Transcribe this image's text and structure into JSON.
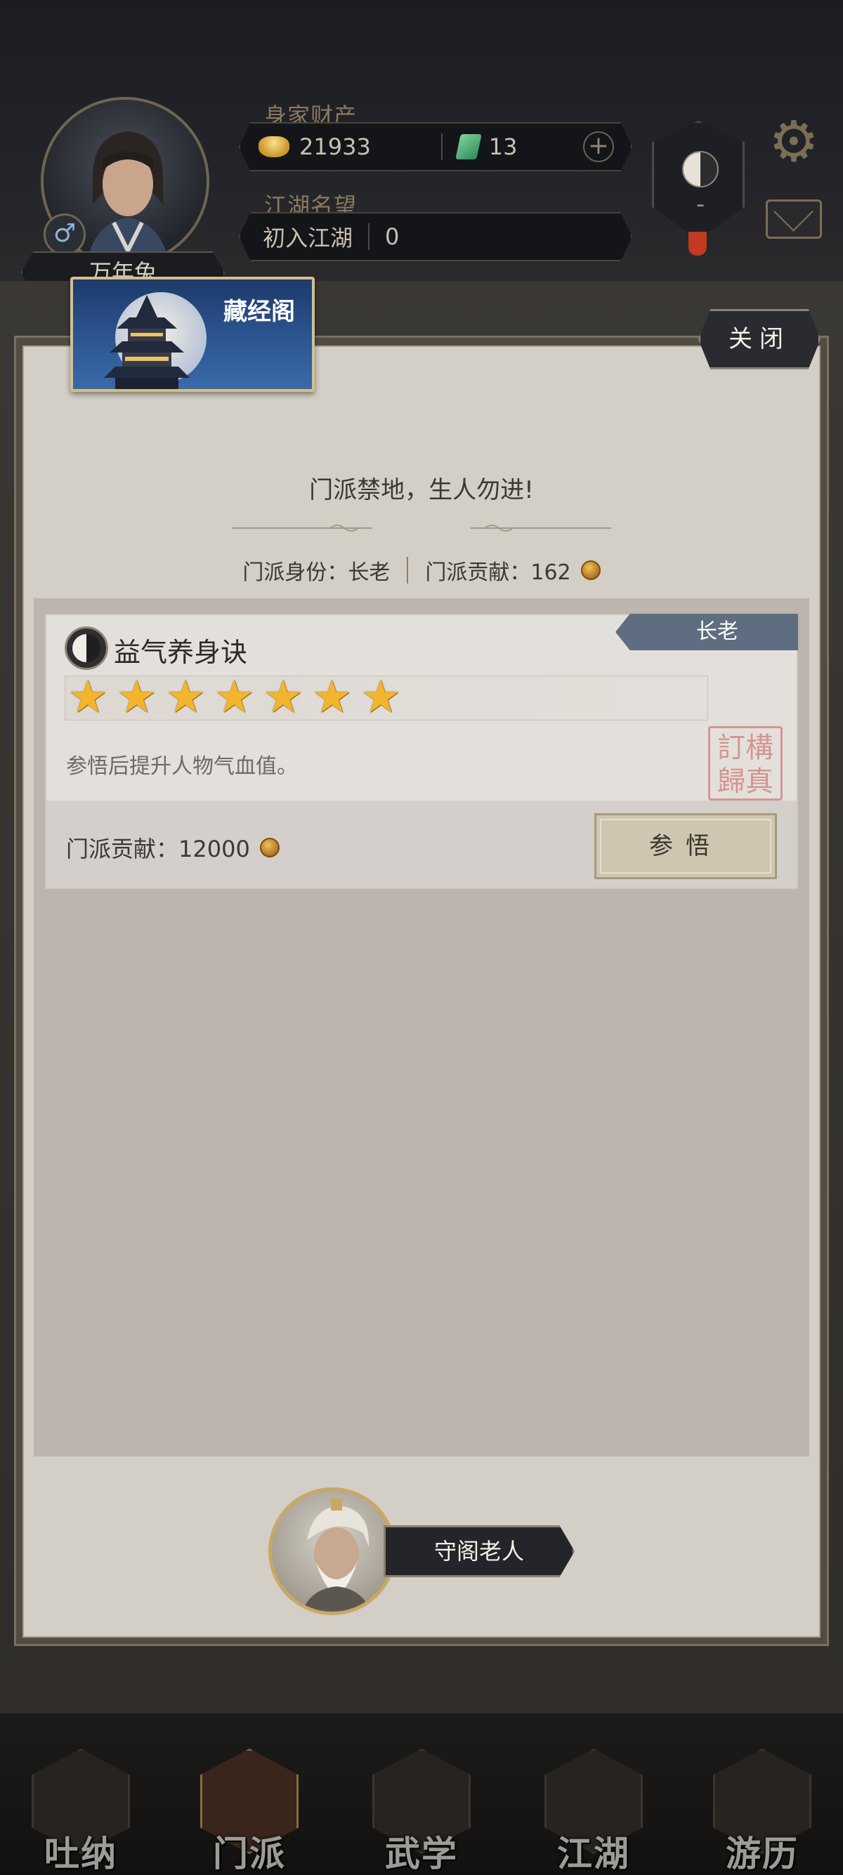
{
  "header": {
    "player_name": "万年兔",
    "gender_symbol": "♂",
    "wealth_label": "身家财产",
    "gold_amount": "21933",
    "jade_amount": "13",
    "reputation_label": "江湖名望",
    "reputation_title": "初入江湖",
    "reputation_value": "0",
    "emblem_dash": "-",
    "add_symbol": "+",
    "gear_symbol": "⚙"
  },
  "modal": {
    "title": "藏经阁",
    "close_label": "关闭",
    "warning": "门派禁地，生人勿进!",
    "identity": "门派身份：长老",
    "contribution": "门派贡献：162"
  },
  "skill": {
    "rank_tag": "长老",
    "name": "益气养身诀",
    "stars": 7,
    "description": "参悟后提升人物气血值。",
    "seal_text": "訂構\n歸真",
    "cost": "门派贡献：12000",
    "study_label": "参悟"
  },
  "npc": {
    "name": "守阁老人"
  },
  "nav": [
    {
      "label": "吐纳",
      "icon": "breathing-icon"
    },
    {
      "label": "门派",
      "icon": "sect-banner-icon"
    },
    {
      "label": "武学",
      "icon": "martial-book-icon"
    },
    {
      "label": "江湖",
      "icon": "bamboo-hat-icon"
    },
    {
      "label": "游历",
      "icon": "horse-icon"
    }
  ],
  "colors": {
    "rank_ribbon": "#5e6d80",
    "star": "#f3b52b",
    "panel": "#d3cec6"
  }
}
